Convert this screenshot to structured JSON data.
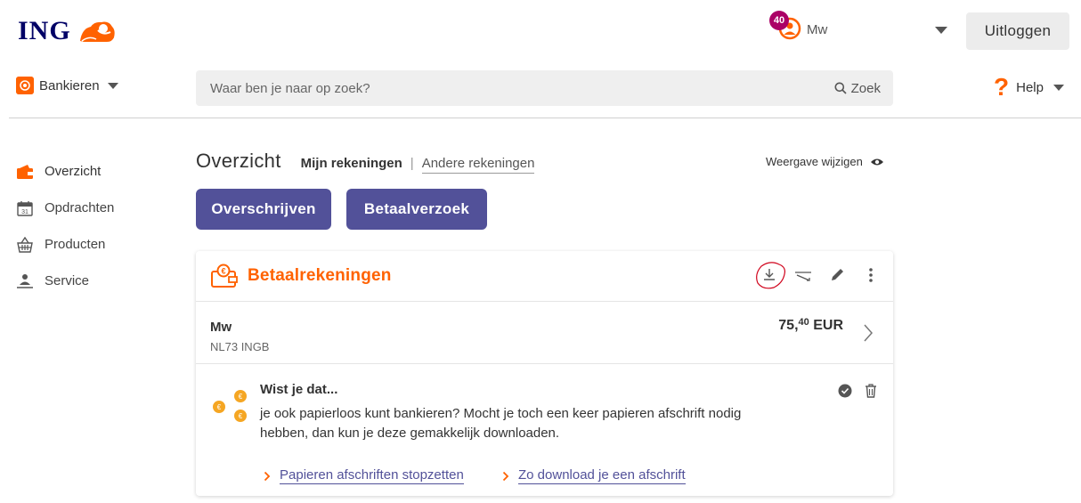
{
  "header": {
    "logo_text": "ING",
    "notification_count": "40",
    "user_name": "Mw",
    "logout_label": "Uitloggen"
  },
  "nav": {
    "bank_menu_label": "Bankieren",
    "search_placeholder": "Waar ben je naar op zoek?",
    "search_button_label": "Zoek",
    "help_label": "Help"
  },
  "sidebar": {
    "items": [
      {
        "label": "Overzicht",
        "icon": "wallet-icon",
        "active": true
      },
      {
        "label": "Opdrachten",
        "icon": "calendar-icon",
        "active": false
      },
      {
        "label": "Producten",
        "icon": "basket-icon",
        "active": false
      },
      {
        "label": "Service",
        "icon": "service-person-icon",
        "active": false
      }
    ]
  },
  "main": {
    "title": "Overzicht",
    "tab_own": "Mijn rekeningen",
    "tab_separator": "|",
    "tab_other": "Andere rekeningen",
    "view_toggle_label": "Weergave wijzigen",
    "transfer_button": "Overschrijven",
    "request_button": "Betaalverzoek"
  },
  "card": {
    "title": "Betaalrekeningen",
    "account": {
      "name": "Mw",
      "iban": "NL73 INGB",
      "amount_whole": "75,",
      "amount_cents": "40",
      "currency": "EUR"
    },
    "tip": {
      "title": "Wist je dat...",
      "text": "je ook papierloos kunt bankieren? Mocht je toch een keer papieren afschrift nodig hebben, dan kun je deze gemakkelijk downloaden.",
      "link_1": "Papieren afschriften stopzetten",
      "link_2": "Zo download je een afschrift"
    }
  },
  "colors": {
    "brand_orange": "#ff6200",
    "brand_navy": "#000066",
    "button_purple": "#525199",
    "badge_magenta": "#ab0066",
    "annotation_red": "#d0021b"
  }
}
